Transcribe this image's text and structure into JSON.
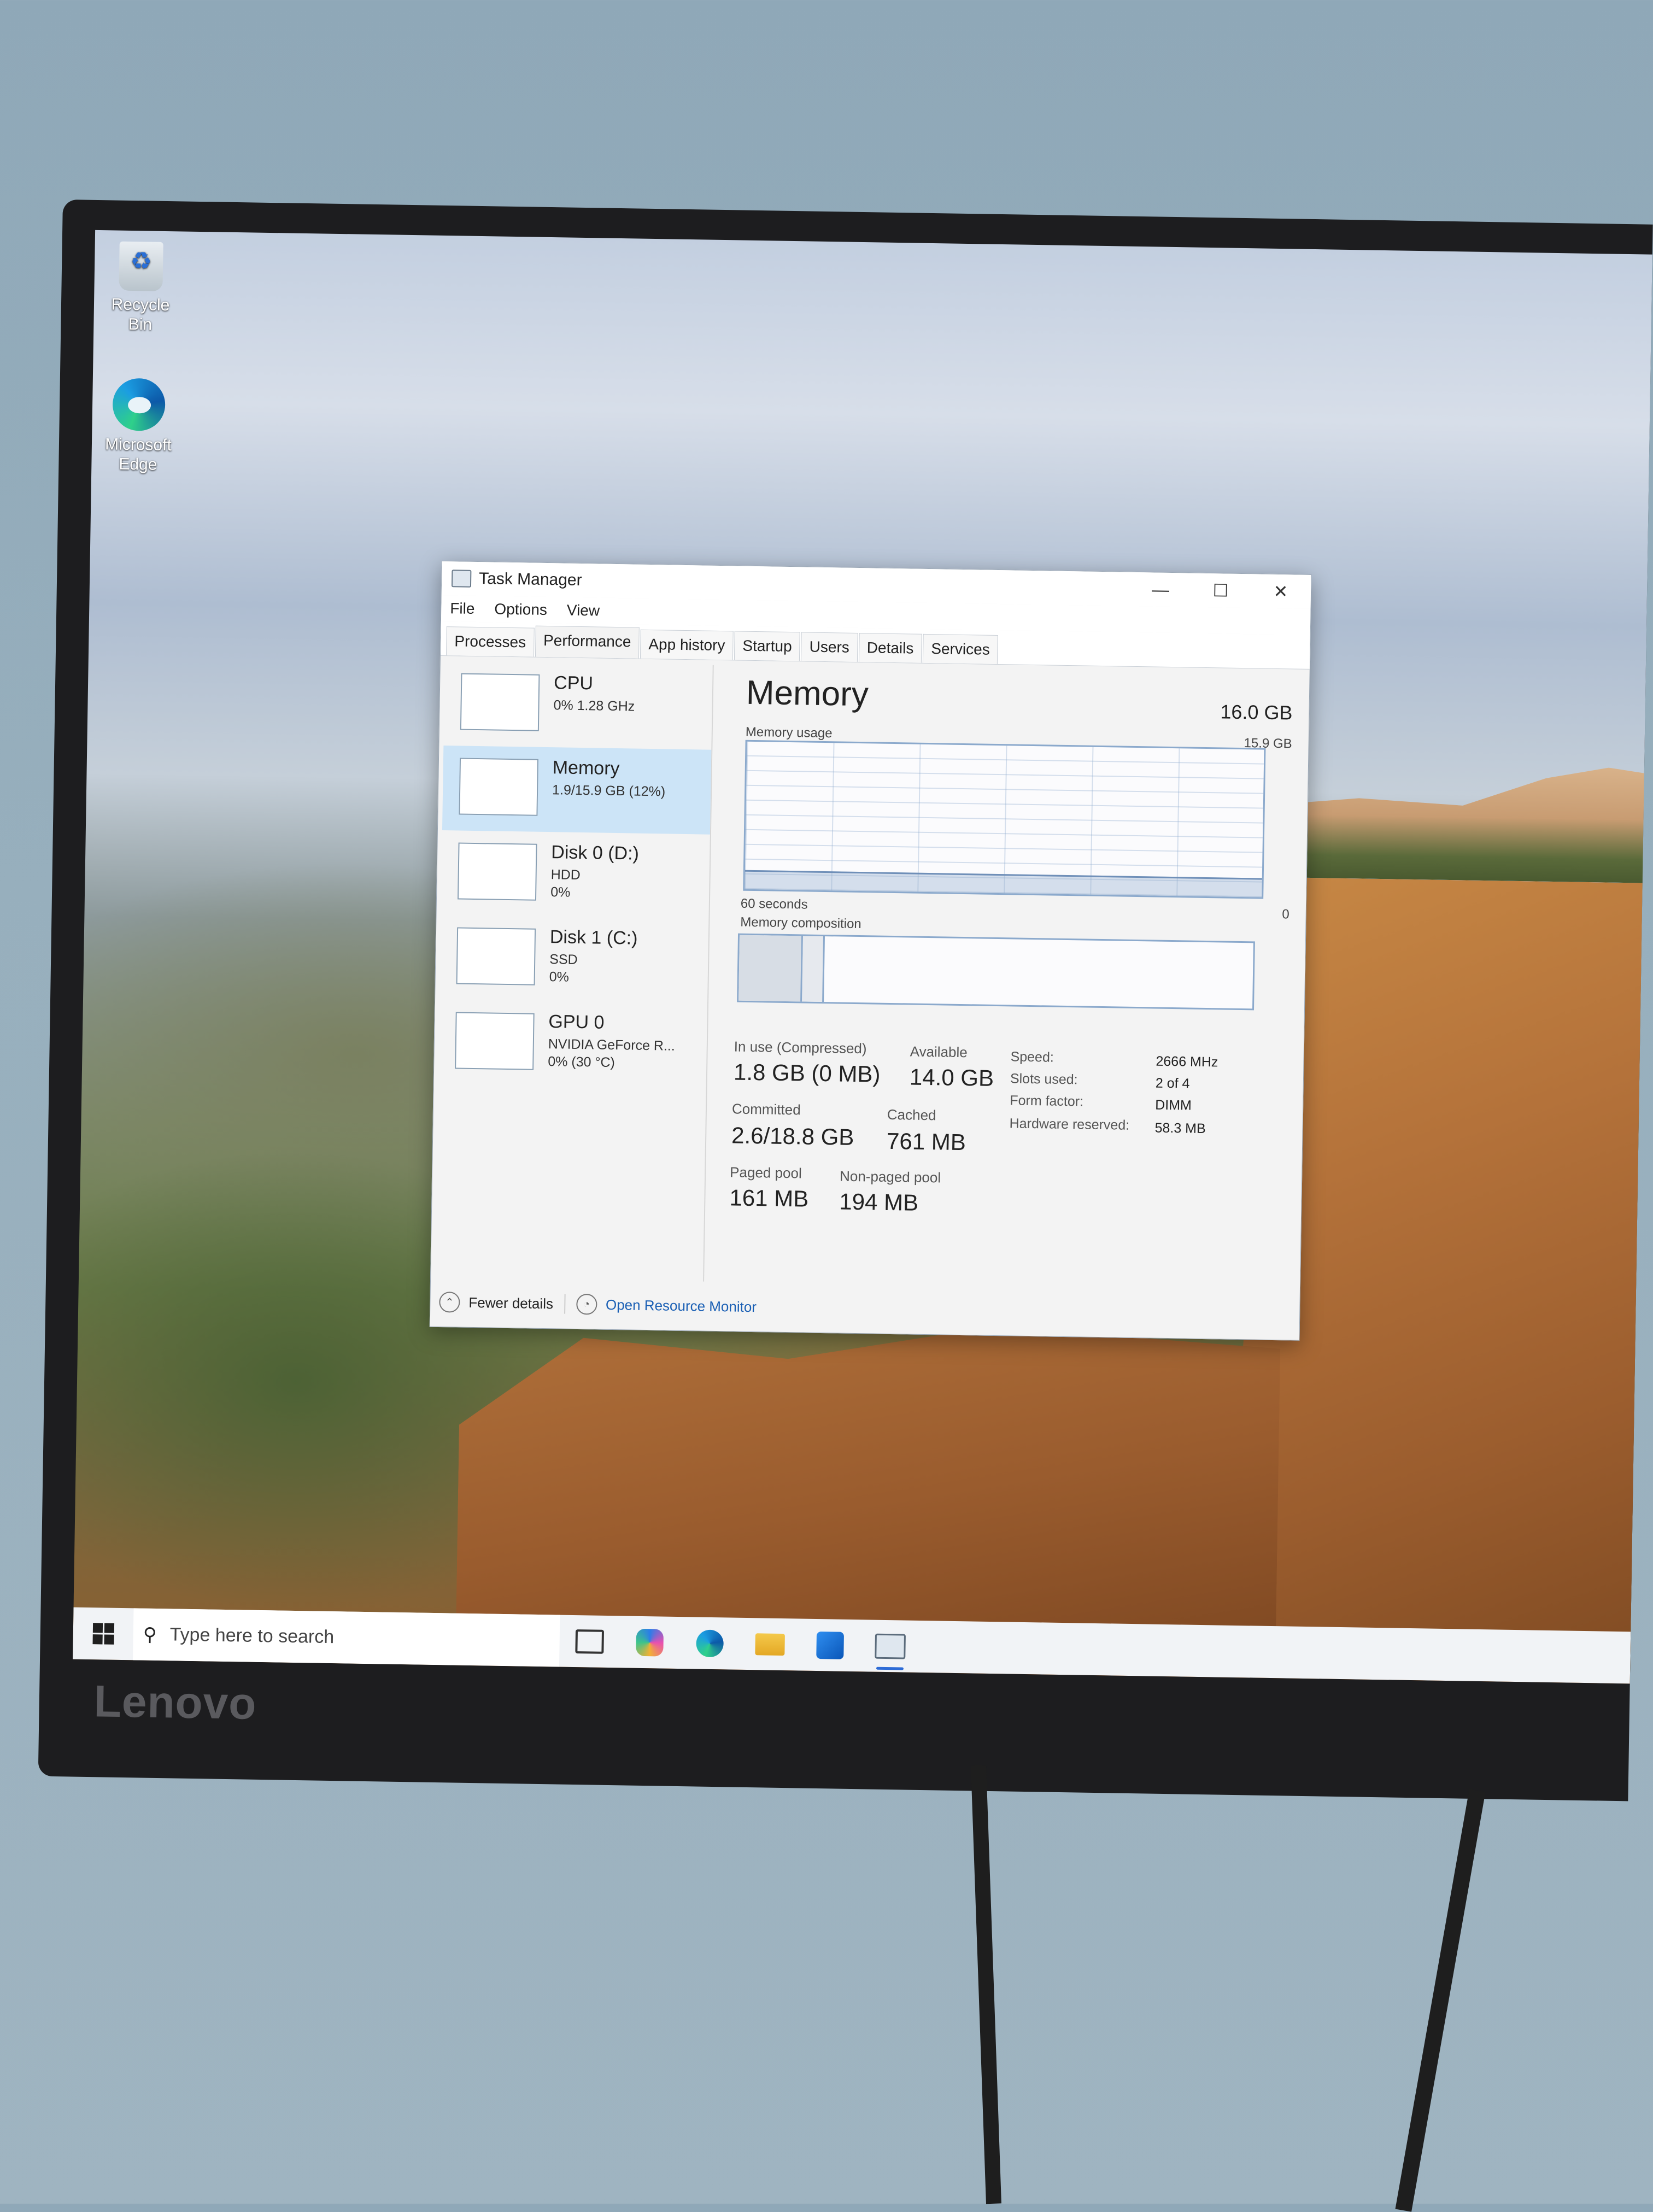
{
  "desktop": {
    "icons": [
      {
        "label": "Recycle Bin"
      },
      {
        "label": "Microsoft Edge"
      }
    ]
  },
  "window": {
    "title": "Task Manager",
    "controls": {
      "minimize": "—",
      "maximize": "☐",
      "close": "✕"
    },
    "menu": [
      "File",
      "Options",
      "View"
    ],
    "tabs": [
      "Processes",
      "Performance",
      "App history",
      "Startup",
      "Users",
      "Details",
      "Services"
    ],
    "active_tab": "Performance"
  },
  "sidebar": {
    "items": [
      {
        "name": "CPU",
        "sub1": "0%  1.28 GHz",
        "sub2": "",
        "sub3": ""
      },
      {
        "name": "Memory",
        "sub1": "1.9/15.9 GB (12%)",
        "sub2": "",
        "sub3": ""
      },
      {
        "name": "Disk 0 (D:)",
        "sub1": "HDD",
        "sub2": "0%",
        "sub3": ""
      },
      {
        "name": "Disk 1 (C:)",
        "sub1": "SSD",
        "sub2": "0%",
        "sub3": ""
      },
      {
        "name": "GPU 0",
        "sub1": "NVIDIA GeForce R...",
        "sub2": "0% (30 °C)",
        "sub3": ""
      }
    ],
    "selected": "Memory"
  },
  "detail": {
    "heading": "Memory",
    "total": "16.0 GB",
    "usage_label": "Memory usage",
    "usage_max": "15.9 GB",
    "time_label": "60 seconds",
    "time_end": "0",
    "usage_fraction": 0.12,
    "composition_label": "Memory composition",
    "composition": {
      "in_use_fraction": 0.12,
      "modified_fraction": 0.04
    },
    "stats": {
      "in_use_label": "In use (Compressed)",
      "in_use_value": "1.8 GB (0 MB)",
      "available_label": "Available",
      "available_value": "14.0 GB",
      "committed_label": "Committed",
      "committed_value": "2.6/18.8 GB",
      "cached_label": "Cached",
      "cached_value": "761 MB",
      "paged_label": "Paged pool",
      "paged_value": "161 MB",
      "nonpaged_label": "Non-paged pool",
      "nonpaged_value": "194 MB"
    },
    "specs": {
      "speed_label": "Speed:",
      "speed_value": "2666 MHz",
      "slots_label": "Slots used:",
      "slots_value": "2 of 4",
      "form_label": "Form factor:",
      "form_value": "DIMM",
      "reserved_label": "Hardware reserved:",
      "reserved_value": "58.3 MB"
    }
  },
  "footer": {
    "fewer_details": "Fewer details",
    "open_resource_monitor": "Open Resource Monitor"
  },
  "taskbar": {
    "search_placeholder": "Type here to search",
    "apps": [
      "task-view",
      "copilot",
      "edge",
      "file-explorer",
      "outlook",
      "task-manager"
    ]
  },
  "bezel": {
    "brand": "Lenovo"
  },
  "colors": {
    "accent": "#2e6bd6",
    "graph_border": "#8ba9cc",
    "selection": "#cce4f7",
    "link": "#1a5fb4"
  }
}
